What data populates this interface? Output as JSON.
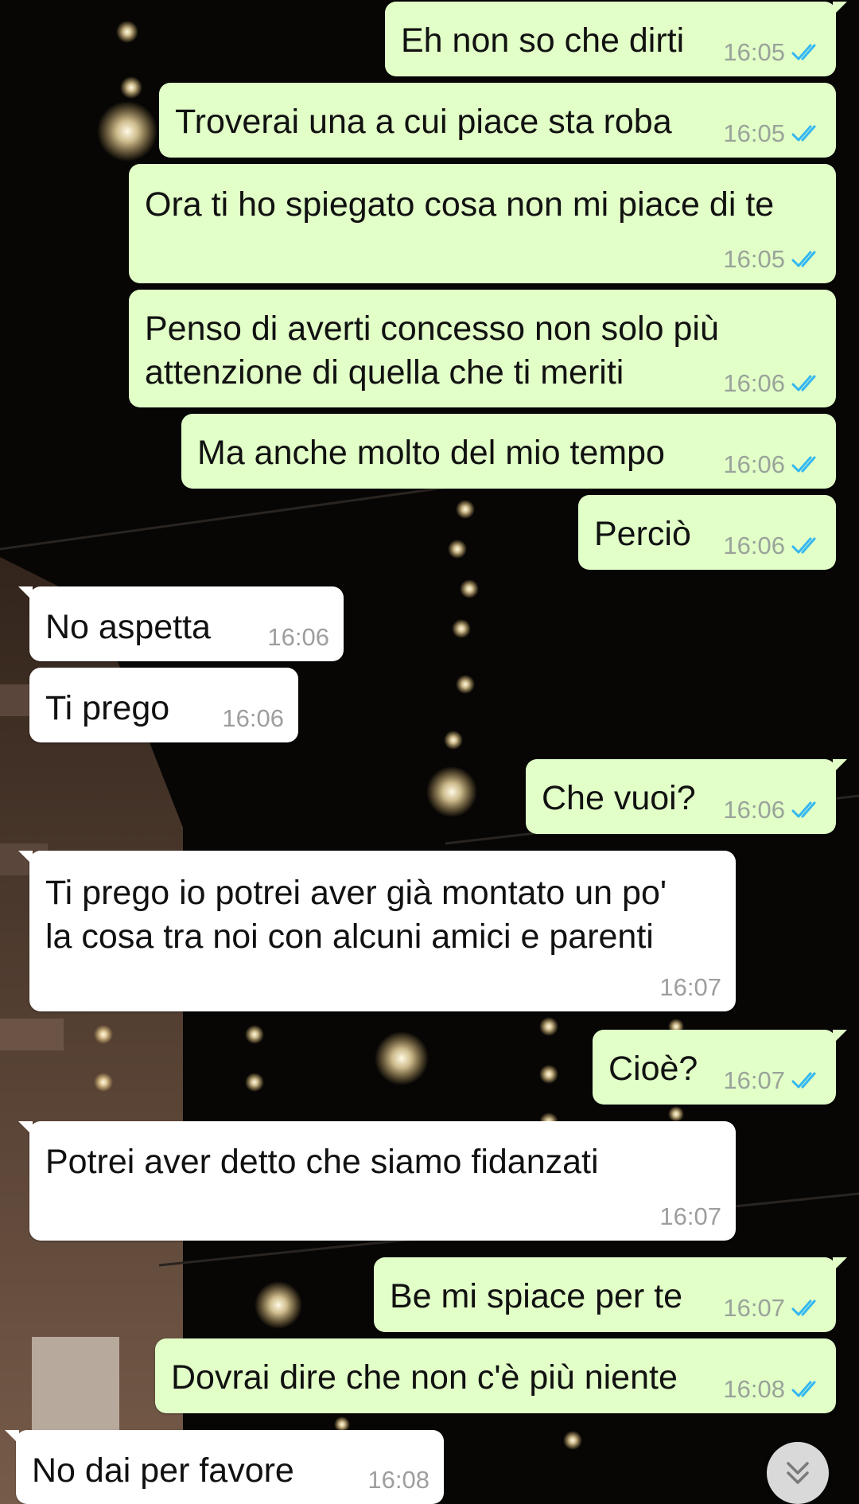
{
  "colors": {
    "outgoing_bubble": "#e1ffc7",
    "incoming_bubble": "#ffffff",
    "read_ticks": "#34b7f1",
    "timestamp": "#9aa39a"
  },
  "messages": [
    {
      "direction": "out",
      "text": "Eh non so che dirti",
      "time": "16:05",
      "status": "read"
    },
    {
      "direction": "out",
      "text": "Troverai una a cui piace sta roba",
      "time": "16:05",
      "status": "read"
    },
    {
      "direction": "out",
      "text": "Ora ti ho spiegato cosa non mi piace di te",
      "time": "16:05",
      "status": "read"
    },
    {
      "direction": "out",
      "text": "Penso di averti concesso non solo più\nattenzione di quella che ti meriti",
      "time": "16:06",
      "status": "read"
    },
    {
      "direction": "out",
      "text": "Ma anche molto del mio tempo",
      "time": "16:06",
      "status": "read"
    },
    {
      "direction": "out",
      "text": "Perciò",
      "time": "16:06",
      "status": "read"
    },
    {
      "direction": "in",
      "text": "No aspetta",
      "time": "16:06"
    },
    {
      "direction": "in",
      "text": "Ti prego",
      "time": "16:06"
    },
    {
      "direction": "out",
      "text": "Che vuoi?",
      "time": "16:06",
      "status": "read"
    },
    {
      "direction": "in",
      "text": "Ti prego io potrei aver già montato un po'\nla cosa tra noi con alcuni amici e parenti",
      "time": "16:07"
    },
    {
      "direction": "out",
      "text": "Cioè?",
      "time": "16:07",
      "status": "read"
    },
    {
      "direction": "in",
      "text": "Potrei aver detto che siamo fidanzati",
      "time": "16:07"
    },
    {
      "direction": "out",
      "text": "Be mi spiace per te",
      "time": "16:07",
      "status": "read"
    },
    {
      "direction": "out",
      "text": "Dovrai dire che non c'è più niente",
      "time": "16:08",
      "status": "read"
    },
    {
      "direction": "in",
      "text": "No dai per favore",
      "time": "16:08"
    }
  ],
  "scroll_button": {
    "icon": "double-chevron-down-icon"
  }
}
